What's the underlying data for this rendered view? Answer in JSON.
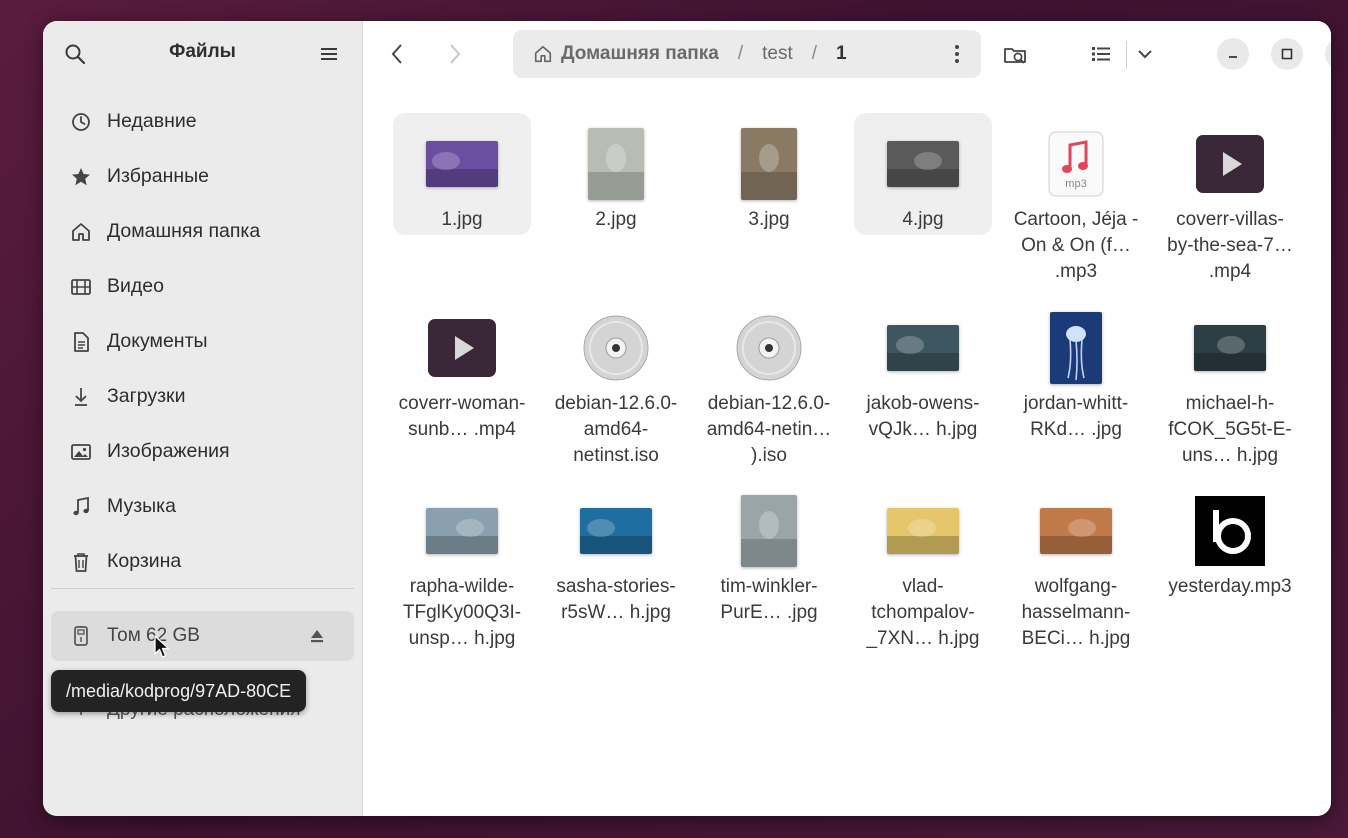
{
  "sidebar": {
    "title": "Файлы",
    "items": [
      {
        "label": "Недавние",
        "icon": "clock-icon"
      },
      {
        "label": "Избранные",
        "icon": "star-icon"
      },
      {
        "label": "Домашняя папка",
        "icon": "home-icon"
      },
      {
        "label": "Видео",
        "icon": "film-icon"
      },
      {
        "label": "Документы",
        "icon": "document-icon"
      },
      {
        "label": "Загрузки",
        "icon": "download-icon"
      },
      {
        "label": "Изображения",
        "icon": "image-icon"
      },
      {
        "label": "Музыка",
        "icon": "music-icon"
      },
      {
        "label": "Корзина",
        "icon": "trash-icon"
      }
    ],
    "volume": {
      "label": "Том 62 GB",
      "icon": "usb-drive-icon"
    },
    "other_locations": "Другие расположения",
    "tooltip": "/media/kodprog/97AD-80CE"
  },
  "path": {
    "crumbs": [
      "Домашняя папка",
      "test",
      "1"
    ],
    "separator": "/"
  },
  "files": [
    {
      "name": "1.jpg",
      "kind": "image",
      "color": "#6a4ea0",
      "highlighted": true
    },
    {
      "name": "2.jpg",
      "kind": "image-portrait",
      "color": "#b8bdb4",
      "highlighted": false
    },
    {
      "name": "3.jpg",
      "kind": "image-portrait",
      "color": "#8a7a64",
      "highlighted": false
    },
    {
      "name": "4.jpg",
      "kind": "image",
      "color": "#5a5a5a",
      "highlighted": true
    },
    {
      "name": "Cartoon, Jéja - On & On (f… .mp3",
      "kind": "audio",
      "color": "#e0465a",
      "highlighted": false
    },
    {
      "name": "coverr-villas-by-the-sea-7… .mp4",
      "kind": "video",
      "color": "#3a2838",
      "highlighted": false
    },
    {
      "name": "coverr-woman-sunb… .mp4",
      "kind": "video",
      "color": "#3a2838",
      "highlighted": false
    },
    {
      "name": "debian-12.6.0-amd64-netinst.iso",
      "kind": "disc",
      "color": "#d0d0d0",
      "highlighted": false
    },
    {
      "name": "debian-12.6.0-amd64-netin… ).iso",
      "kind": "disc",
      "color": "#d0d0d0",
      "highlighted": false
    },
    {
      "name": "jakob-owens-vQJk… h.jpg",
      "kind": "image",
      "color": "#3e5660",
      "highlighted": false
    },
    {
      "name": "jordan-whitt-RKd… .jpg",
      "kind": "image-portrait-tall",
      "color": "#1b3a78",
      "highlighted": false
    },
    {
      "name": "michael-h-fCOK_5G5t-E-uns… h.jpg",
      "kind": "image",
      "color": "#2c3e44",
      "highlighted": false
    },
    {
      "name": "rapha-wilde-TFglKy00Q3I-unsp… h.jpg",
      "kind": "image",
      "color": "#8aa0b0",
      "highlighted": false
    },
    {
      "name": "sasha-stories-r5sW… h.jpg",
      "kind": "image",
      "color": "#1e6ea0",
      "highlighted": false
    },
    {
      "name": "tim-winkler-PurE… .jpg",
      "kind": "image-portrait",
      "color": "#9aa5a8",
      "highlighted": false
    },
    {
      "name": "vlad-tchompalov-_7XN… h.jpg",
      "kind": "image",
      "color": "#e6c66a",
      "highlighted": false
    },
    {
      "name": "wolfgang-hasselmann-BECi… h.jpg",
      "kind": "image",
      "color": "#c07a4a",
      "highlighted": false
    },
    {
      "name": "yesterday.mp3",
      "kind": "logo",
      "color": "#000000",
      "highlighted": false
    }
  ],
  "colors": {
    "sidebar_bg": "#ebebeb",
    "accent": "#3584e4",
    "video_icon": "#3a2838"
  }
}
